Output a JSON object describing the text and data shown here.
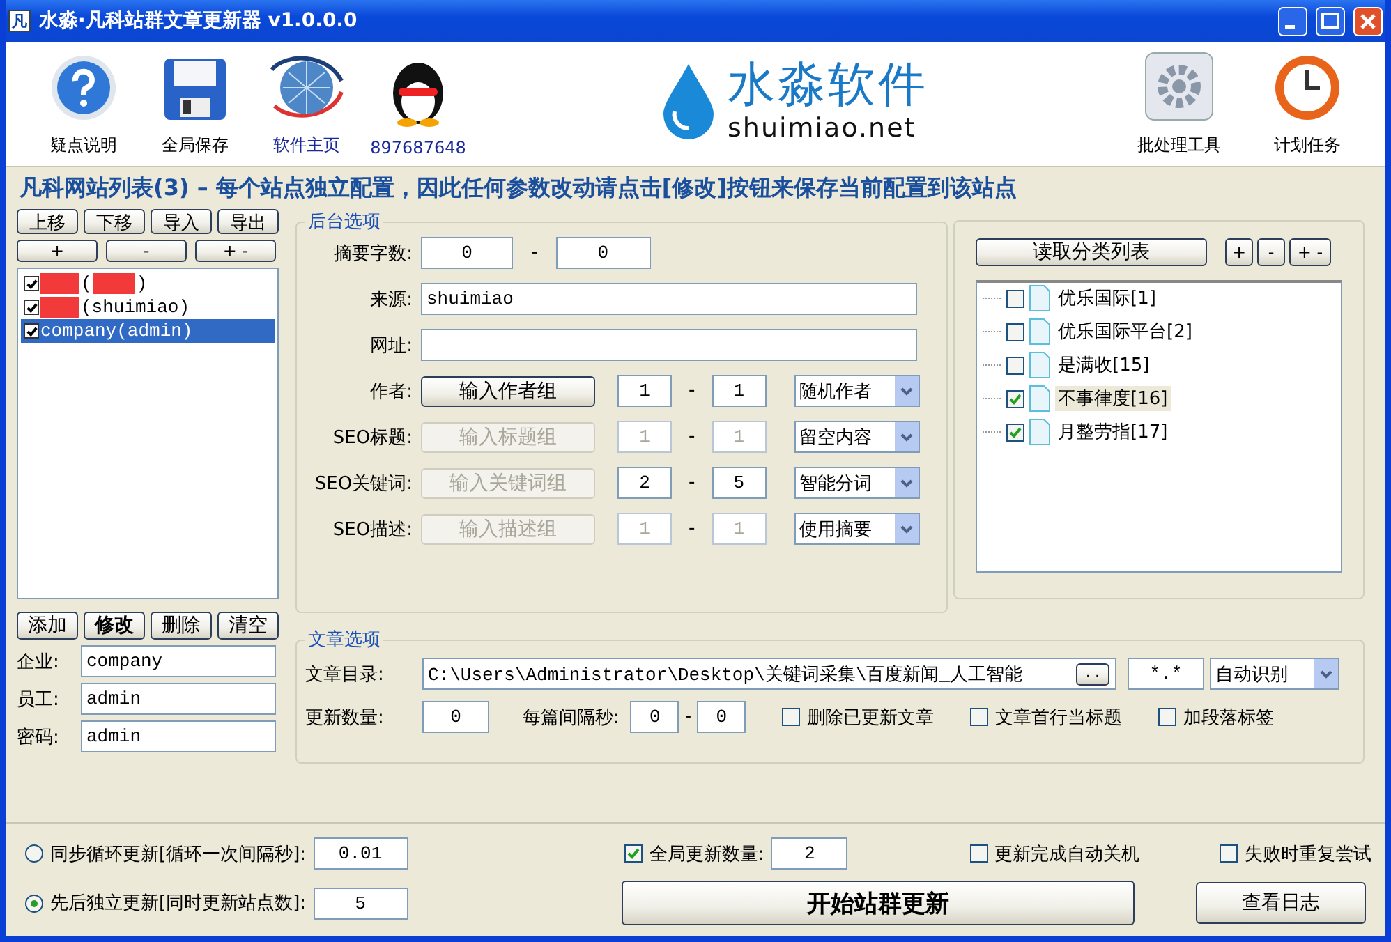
{
  "window": {
    "title": "水淼·凡科站群文章更新器 v1.0.0.0",
    "icon": "凡"
  },
  "toolbar": [
    {
      "label": "疑点说明",
      "kind": "help",
      "link": false
    },
    {
      "label": "全局保存",
      "kind": "save",
      "link": false
    },
    {
      "label": "软件主页",
      "kind": "globe",
      "link": true
    },
    {
      "label": "897687648",
      "kind": "penguin",
      "link": true
    }
  ],
  "logo": {
    "name": "水淼软件",
    "url": "shuimiao.net"
  },
  "toolbar_right": [
    {
      "label": "批处理工具",
      "kind": "gear",
      "link": false
    },
    {
      "label": "计划任务",
      "kind": "clock",
      "link": false
    }
  ],
  "heading": "凡科网站列表(3) – 每个站点独立配置，因此任何参数改动请点击[修改]按钮来保存当前配置到该站点",
  "site_buttons": [
    "上移",
    "下移",
    "导入",
    "导出"
  ],
  "site_buttons2": [
    "+",
    "-",
    "+ -"
  ],
  "sites": [
    {
      "parts": [
        "(",
        ")"
      ],
      "redacted": true,
      "checked": true,
      "selected": false
    },
    {
      "parts": [
        "(shuimiao)"
      ],
      "redacted": true,
      "checked": true,
      "selected": false
    },
    {
      "parts": [
        "company(admin)"
      ],
      "redacted": false,
      "checked": true,
      "selected": true
    }
  ],
  "site_actions": [
    {
      "label": "添加",
      "bold": false
    },
    {
      "label": "修改",
      "bold": true
    },
    {
      "label": "删除",
      "bold": false
    },
    {
      "label": "清空",
      "bold": false
    }
  ],
  "account_fields": [
    {
      "label": "企业:",
      "value": "company"
    },
    {
      "label": "员工:",
      "value": "admin"
    },
    {
      "label": "密码:",
      "value": "admin"
    }
  ],
  "backend": {
    "title": "后台选项",
    "summary": {
      "label": "摘要字数:",
      "min": "0",
      "sep": "-",
      "max": "0"
    },
    "source": {
      "label": "来源:",
      "value": "shuimiao"
    },
    "url": {
      "label": "网址:"
    },
    "groups": [
      {
        "label": "作者:",
        "button": "输入作者组",
        "disabled": false,
        "inputs_disabled": false,
        "min": "1",
        "sep": "-",
        "max": "1",
        "mode": "随机作者"
      },
      {
        "label": "SEO标题:",
        "button": "输入标题组",
        "disabled": true,
        "inputs_disabled": true,
        "min": "1",
        "sep": "-",
        "max": "1",
        "mode": "留空内容"
      },
      {
        "label": "SEO关键词:",
        "button": "输入关键词组",
        "disabled": true,
        "inputs_disabled": false,
        "min": "2",
        "sep": "-",
        "max": "5",
        "mode": "智能分词"
      },
      {
        "label": "SEO描述:",
        "button": "输入描述组",
        "disabled": true,
        "inputs_disabled": true,
        "min": "1",
        "sep": "-",
        "max": "1",
        "mode": "使用摘要"
      }
    ]
  },
  "categories": {
    "button": "读取分类列表",
    "small_buttons": [
      "+",
      "-",
      "+ -"
    ],
    "items": [
      {
        "label": "优乐国际[1]",
        "checked": false,
        "selected": false
      },
      {
        "label": "优乐国际平台[2]",
        "checked": false,
        "selected": false
      },
      {
        "label": "是满收[15]",
        "checked": false,
        "selected": false
      },
      {
        "label": "不事律度[16]",
        "checked": true,
        "selected": true
      },
      {
        "label": "月整劳指[17]",
        "checked": true,
        "selected": false
      }
    ]
  },
  "article": {
    "title": "文章选项",
    "dir_label": "文章目录:",
    "dir": "C:\\Users\\Administrator\\Desktop\\关键词采集\\百度新闻_人工智能",
    "browse": "..",
    "pattern": "*.*",
    "encoding": "自动识别",
    "count_label": "更新数量:",
    "count": "0",
    "interval_label": "每篇间隔秒:",
    "interval_min": "0",
    "sep": "-",
    "interval_max": "0",
    "options": [
      {
        "label": "删除已更新文章",
        "checked": false
      },
      {
        "label": "文章首行当标题",
        "checked": false
      },
      {
        "label": "加段落标签",
        "checked": false
      }
    ]
  },
  "bottom": {
    "modes": [
      {
        "label": "同步循环更新[循环一次间隔秒]:",
        "value": "0.01",
        "selected": false
      },
      {
        "label": "先后独立更新[同时更新站点数]:",
        "value": "5",
        "selected": true
      }
    ],
    "global": {
      "label": "全局更新数量:",
      "checked": true,
      "value": "2"
    },
    "options": [
      {
        "label": "更新完成自动关机",
        "checked": false
      },
      {
        "label": "失败时重复尝试",
        "checked": false
      }
    ],
    "start": "开始站群更新",
    "log": "查看日志"
  }
}
